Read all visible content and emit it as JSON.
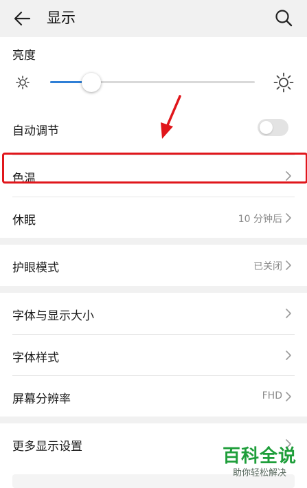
{
  "header": {
    "title": "显示"
  },
  "brightness": {
    "label": "亮度",
    "value_percent": 20
  },
  "auto_adjust": {
    "label": "自动调节",
    "enabled": false
  },
  "color_temp": {
    "label": "色温"
  },
  "sleep": {
    "label": "休眠",
    "value": "10 分钟后"
  },
  "eye_comfort": {
    "label": "护眼模式",
    "value": "已关闭"
  },
  "font_display_size": {
    "label": "字体与显示大小"
  },
  "font_style": {
    "label": "字体样式"
  },
  "resolution": {
    "label": "屏幕分辨率",
    "value": "FHD"
  },
  "more_settings": {
    "label": "更多显示设置"
  },
  "watermark": {
    "title": "百科全说",
    "subtitle": "助你轻松解决"
  },
  "colors": {
    "accent": "#2f7fd6",
    "highlight": "#e0161b",
    "watermark_green": "#1e9e3a"
  }
}
